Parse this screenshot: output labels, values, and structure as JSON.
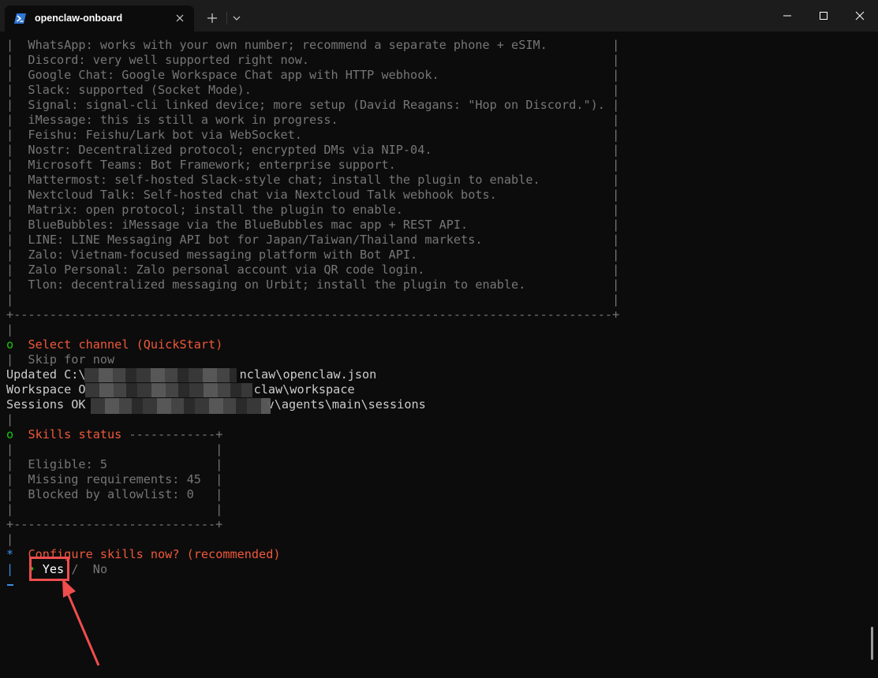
{
  "tab": {
    "title": "openclaw-onboard",
    "icon": "powershell-icon"
  },
  "channels_box": {
    "lines": [
      "|  WhatsApp: works with your own number; recommend a separate phone + eSIM.         |",
      "|  Discord: very well supported right now.                                          |",
      "|  Google Chat: Google Workspace Chat app with HTTP webhook.                        |",
      "|  Slack: supported (Socket Mode).                                                  |",
      "|  Signal: signal-cli linked device; more setup (David Reagans: \"Hop on Discord.\"). |",
      "|  iMessage: this is still a work in progress.                                      |",
      "|  Feishu: Feishu/Lark bot via WebSocket.                                           |",
      "|  Nostr: Decentralized protocol; encrypted DMs via NIP-04.                         |",
      "|  Microsoft Teams: Bot Framework; enterprise support.                              |",
      "|  Mattermost: self-hosted Slack-style chat; install the plugin to enable.          |",
      "|  Nextcloud Talk: Self-hosted chat via Nextcloud Talk webhook bots.                |",
      "|  Matrix: open protocol; install the plugin to enable.                             |",
      "|  BlueBubbles: iMessage via the BlueBubbles mac app + REST API.                    |",
      "|  LINE: LINE Messaging API bot for Japan/Taiwan/Thailand markets.                  |",
      "|  Zalo: Vietnam-focused messaging platform with Bot API.                           |",
      "|  Zalo Personal: Zalo personal account via QR code login.                          |",
      "|  Tlon: decentralized messaging on Urbit; install the plugin to enable.            |",
      "|                                                                                   |",
      "+-----------------------------------------------------------------------------------+",
      "|"
    ]
  },
  "select_channel": {
    "marker": "o",
    "title": "Select channel (QuickStart)",
    "choice": "|  Skip for now"
  },
  "status_lines": {
    "updated": {
      "prefix": "Updated C:\\",
      "suffix": "nclaw\\openclaw.json"
    },
    "workspace": {
      "prefix": "Workspace O",
      "suffix": "claw\\workspace"
    },
    "sessions": {
      "prefix": "Sessions OK",
      "suffix": "v\\agents\\main\\sessions"
    }
  },
  "skills": {
    "pipe_before": "|",
    "marker": "o",
    "title": "Skills status",
    "header_tail": " ------------+",
    "lines": [
      "|                            |",
      "|  Eligible: 5               |",
      "|  Missing requirements: 45  |",
      "|  Blocked by allowlist: 0   |",
      "|                            |",
      "+----------------------------+",
      "|"
    ]
  },
  "configure": {
    "marker": "*",
    "question": "Configure skills now? (recommended)",
    "pipe": "|",
    "bullet": "•",
    "yes": "Yes",
    "separator": " / ",
    "no": "No"
  }
}
